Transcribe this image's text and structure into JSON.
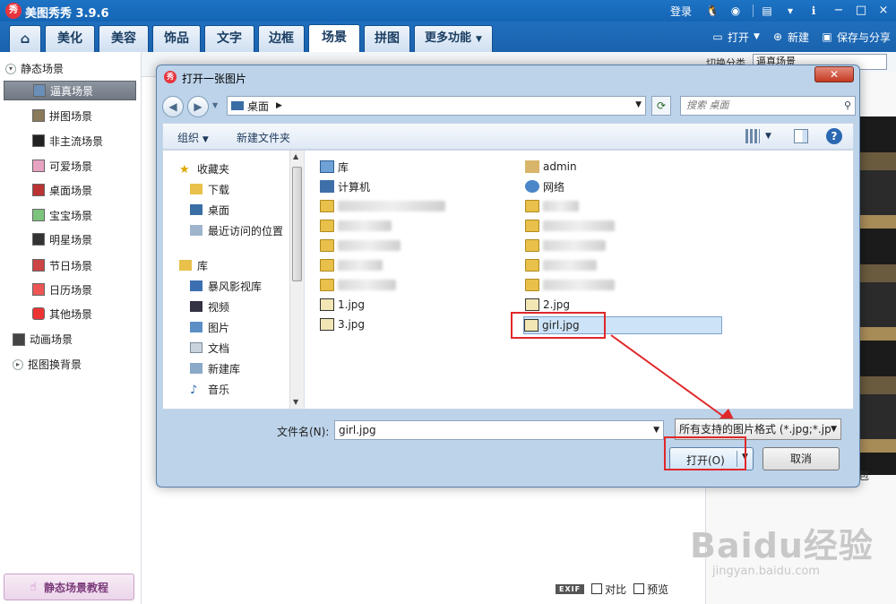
{
  "app": {
    "title": "美图秀秀 3.9.6",
    "login": "登录",
    "window_buttons": [
      "−",
      "□",
      "×"
    ]
  },
  "tabs": [
    "美化",
    "美容",
    "饰品",
    "文字",
    "边框",
    "场景",
    "拼图",
    "更多功能"
  ],
  "active_tab": "场景",
  "actions": {
    "open": "打开",
    "new": "新建",
    "save_share": "保存与分享"
  },
  "switch_category": {
    "label": "切换分类",
    "value": "逼真场景"
  },
  "sidebar": {
    "static_group": "静态场景",
    "items": [
      "逼真场景",
      "拼图场景",
      "非主流场景",
      "可爱场景",
      "桌面场景",
      "宝宝场景",
      "明星场景",
      "节日场景",
      "日历场景",
      "其他场景"
    ],
    "selected": "逼真场景",
    "animated_group": "动画场景",
    "matting_group": "抠图换背景",
    "tutorial_button": "静态场景教程"
  },
  "status_bar": {
    "exif": "EXIF",
    "compare": "对比",
    "preview": "预览"
  },
  "right_panel_peek": "包",
  "watermark": {
    "main": "Baidu经验",
    "sub": "jingyan.baidu.com"
  },
  "dialog": {
    "title": "打开一张图片",
    "address": "桌面",
    "search_placeholder": "搜索 桌面",
    "organize": "组织",
    "new_folder": "新建文件夹",
    "nav_favorites_head": "收藏夹",
    "nav_favorites": [
      "下载",
      "桌面",
      "最近访问的位置"
    ],
    "nav_library_head": "库",
    "nav_library": [
      "暴风影视库",
      "视频",
      "图片",
      "文档",
      "新建库",
      "音乐"
    ],
    "files_left": [
      "库",
      "计算机",
      "1.jpg",
      "3.jpg"
    ],
    "files_right": [
      "admin",
      "网络",
      "2.jpg",
      "girl.jpg"
    ],
    "selected_file": "girl.jpg",
    "filename_label": "文件名(N):",
    "filename_value": "girl.jpg",
    "filetype_value": "所有支持的图片格式 (*.jpg;*.jp",
    "open_button": "打开(O)",
    "cancel_button": "取消"
  },
  "colors": {
    "title_blue": "#1d73c4",
    "highlight_red": "#e0282a",
    "tab_active": "#ffffff"
  }
}
